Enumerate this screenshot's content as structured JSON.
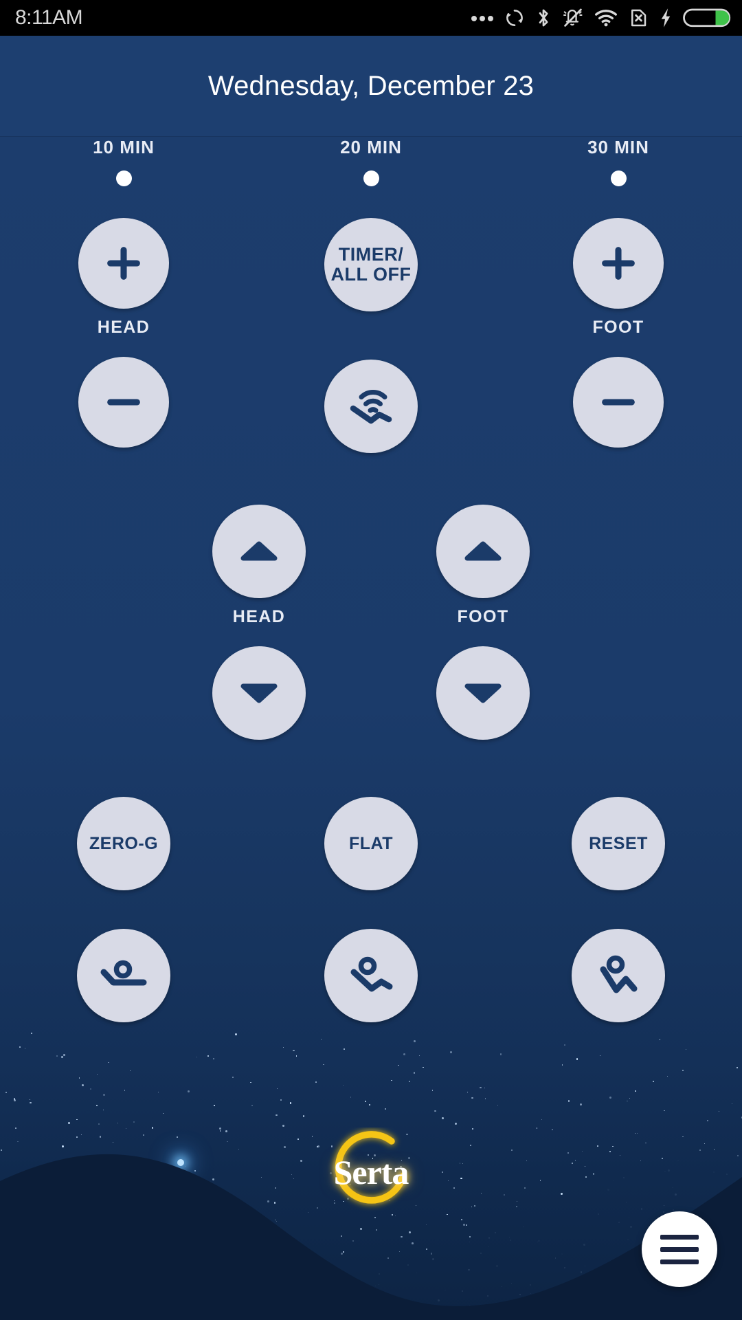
{
  "statusbar": {
    "time": "8:11AM",
    "icons": [
      "more-dots",
      "sync",
      "bluetooth",
      "silent-bell",
      "wifi",
      "no-sim",
      "charging-bolt",
      "battery"
    ]
  },
  "header": {
    "title": "Wednesday, December 23"
  },
  "timer": {
    "presets": [
      {
        "label": "10 MIN",
        "active": true
      },
      {
        "label": "20 MIN",
        "active": true
      },
      {
        "label": "30 MIN",
        "active": true
      }
    ],
    "center_button": {
      "line1": "TIMER/",
      "line2": "ALL OFF"
    },
    "massage_button": "massage-wave-icon"
  },
  "massage_controls": {
    "head": {
      "label": "HEAD",
      "plus": "+",
      "minus": "−"
    },
    "foot": {
      "label": "FOOT",
      "plus": "+",
      "minus": "−"
    }
  },
  "position_controls": {
    "head": {
      "label": "HEAD",
      "up": "up-arrow-icon",
      "down": "down-arrow-icon"
    },
    "foot": {
      "label": "FOOT",
      "up": "up-arrow-icon",
      "down": "down-arrow-icon"
    }
  },
  "presets": [
    {
      "label": "ZERO-G"
    },
    {
      "label": "FLAT"
    },
    {
      "label": "RESET"
    }
  ],
  "position_presets": [
    {
      "icon": "bed-flat-recline-icon"
    },
    {
      "icon": "bed-zero-g-icon"
    },
    {
      "icon": "bed-raised-icon"
    }
  ],
  "footer": {
    "logo_text": "Serta",
    "menu_button": "hamburger-menu-icon"
  },
  "colors": {
    "brand_blue": "#1b3b69",
    "header_blue": "#1d3f70",
    "button_face": "#d8dae6",
    "logo_gold": "#f5c518",
    "battery_green": "#3fc24a"
  }
}
